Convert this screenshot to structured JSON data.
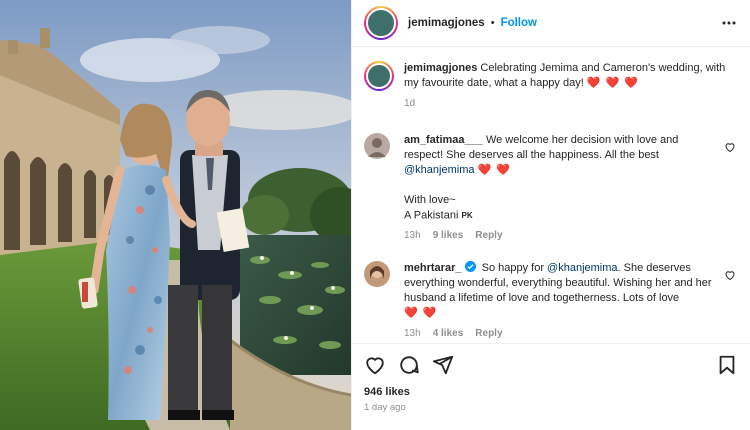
{
  "post": {
    "username": "jemimagjones",
    "separator": "•",
    "follow_label": "Follow",
    "more_icon": "more-horizontal-icon"
  },
  "caption": {
    "username": "jemimagjones",
    "text": "Celebrating Jemima and Cameron's wedding, with my favourite date, what a happy day!",
    "hearts": "❤️ ❤️ ❤️",
    "time": "1d"
  },
  "comments": [
    {
      "username": "am_fatimaa___",
      "text": "We welcome her decision with love and respect! She deserves all the happiness. All the best",
      "mention": "@khanjemima",
      "hearts": "❤️ ❤️",
      "line2": "With love~",
      "line3": "A Pakistani",
      "flag": "PK",
      "time": "13h",
      "likes": "9 likes",
      "reply": "Reply"
    },
    {
      "username": "mehrtarar_",
      "text_before": "So happy for",
      "mention": "@khanjemima",
      "text_after": ". She deserves everything wonderful, everything beautiful. Wishing her and her husband a lifetime of love and togetherness. Lots of love",
      "hearts": "❤️ ❤️",
      "time": "13h",
      "likes": "4 likes",
      "reply": "Reply"
    }
  ],
  "footer": {
    "likes": "946 likes",
    "posted": "1 day ago"
  },
  "icons": [
    "heart-icon",
    "comment-icon",
    "share-icon",
    "bookmark-icon"
  ],
  "colors": {
    "accent": "#0095f6",
    "heart": "#e8173a",
    "muted": "#8e8e8e"
  }
}
